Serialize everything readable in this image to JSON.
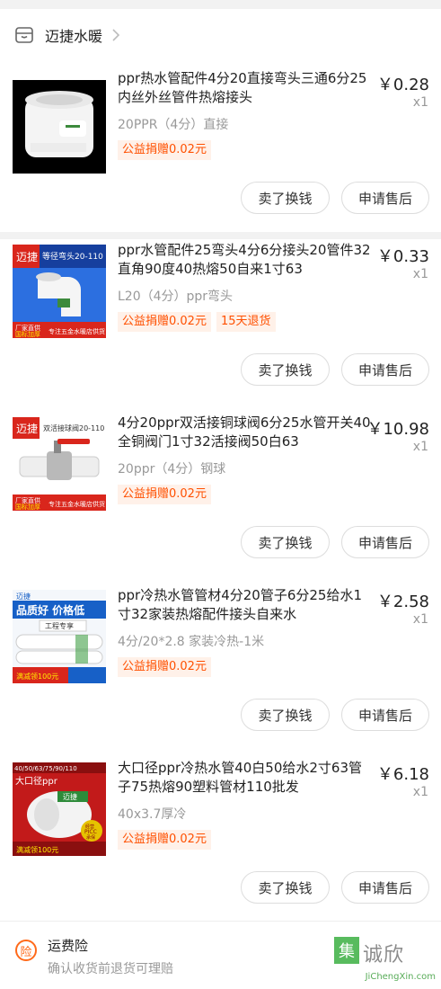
{
  "shop": {
    "name": "迈捷水暖"
  },
  "items": [
    {
      "title": "ppr热水管配件4分20直接弯头三通6分25内丝外丝管件热熔接头",
      "spec": "20PPR（4分）直接",
      "tags": [
        "公益捐赠0.02元"
      ],
      "price": "￥0.28",
      "qty": "x1",
      "image_text": []
    },
    {
      "title": "ppr水管配件25弯头4分6分接头20管件32直角90度40热熔50自来1寸63",
      "spec": "L20（4分）ppr弯头",
      "tags": [
        "公益捐赠0.02元",
        "15天退货"
      ],
      "price": "￥0.33",
      "qty": "x1",
      "image_text": [
        "迈捷",
        "等径弯头20-110",
        "厂家直供",
        "国标加厚",
        "专注五金水暖店供货"
      ]
    },
    {
      "title": "4分20ppr双活接铜球阀6分25水管开关40全铜阀门1寸32活接阀50白63",
      "spec": "20ppr（4分）钢球",
      "tags": [
        "公益捐赠0.02元"
      ],
      "price": "￥10.98",
      "qty": "x1",
      "image_text": [
        "迈捷",
        "双活接球阀20-110",
        "厂家直供",
        "国标加厚",
        "专注五金水暖店供货"
      ]
    },
    {
      "title": "ppr冷热水管管材4分20管子6分25给水1寸32家装热熔配件接头自来水",
      "spec": "4分/20*2.8 家装冷热-1米",
      "tags": [
        "公益捐赠0.02元"
      ],
      "price": "￥2.58",
      "qty": "x1",
      "image_text": [
        "迈捷",
        "品质好 价格低",
        "工程专享",
        "满减领100元"
      ]
    },
    {
      "title": "大口径ppr冷热水管40白50给水2寸63管子75热熔90塑料管材110批发",
      "spec": "40x3.7厚冷",
      "tags": [
        "公益捐赠0.02元"
      ],
      "price": "￥6.18",
      "qty": "x1",
      "image_text": [
        "40/50/63/75/90/110",
        "大口径ppr",
        "迈捷",
        "经营",
        "PICC",
        "承保",
        "满减领100元"
      ]
    }
  ],
  "buttons": {
    "exchange": "卖了换钱",
    "aftersale": "申请售后"
  },
  "insurance": {
    "badge": "险",
    "title": "运费险",
    "desc": "确认收货前退货可理赔"
  },
  "watermark": {
    "box": "集",
    "big": "诚欣",
    "url": "JiChengXin.com"
  },
  "colors": {
    "accent": "#ff5000",
    "tag_bg": "#fff1e9",
    "red_banner": "#d9261c",
    "blue_banner": "#1760c7",
    "watermark_green": "#3cb043"
  }
}
